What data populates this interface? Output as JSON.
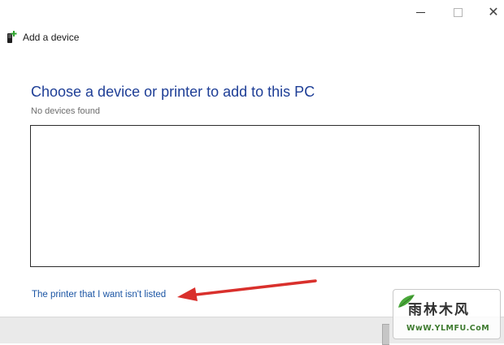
{
  "window": {
    "title": "Add a device",
    "caption_buttons": {
      "minimize": "minimize",
      "maximize": "maximize",
      "close": "✕"
    }
  },
  "main": {
    "heading": "Choose a device or printer to add to this PC",
    "status": "No devices found",
    "link": "The printer that I want isn't listed"
  },
  "watermark": {
    "chars": "雨林木风",
    "url": "WwW.YLMFU.CoM"
  },
  "colors": {
    "heading": "#1e3e96",
    "link": "#1b55a4",
    "arrow": "#d9302c",
    "footer": "#eaeaea"
  },
  "icons": {
    "app": "device-add-icon"
  }
}
